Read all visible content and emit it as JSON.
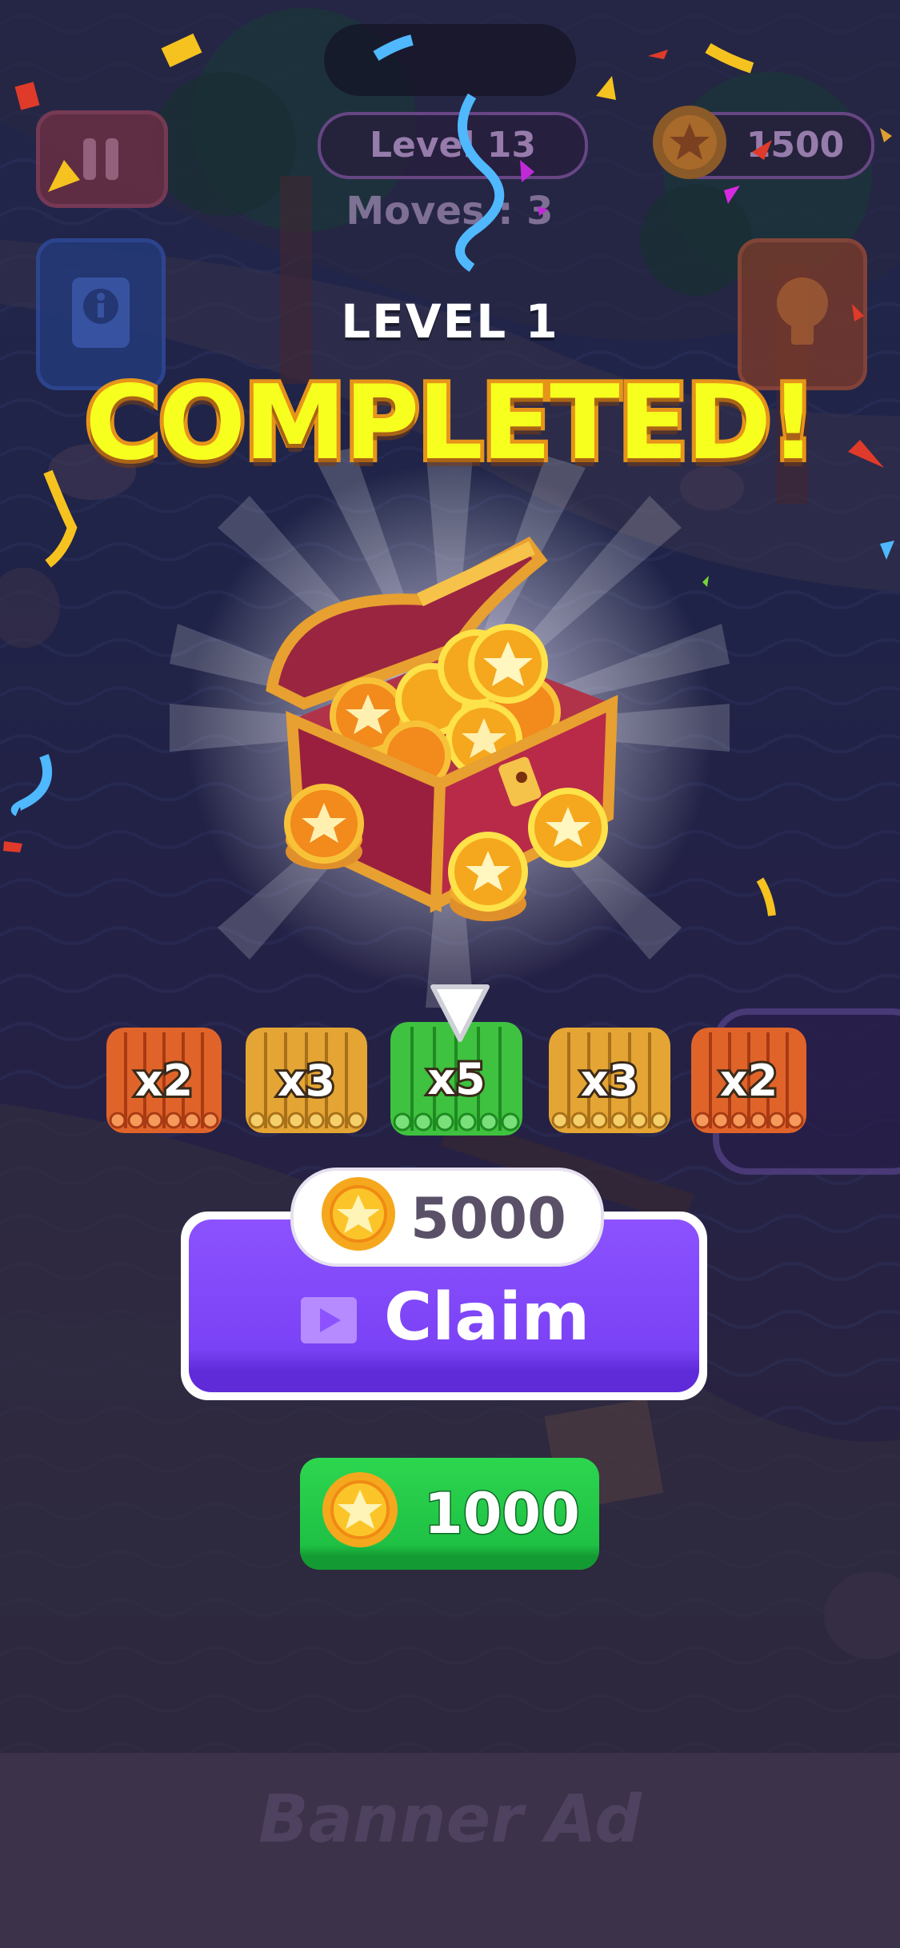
{
  "hud": {
    "level_label": "Level 13",
    "moves_label": "Moves : 3",
    "coins": "1500",
    "pause_icon": "pause-icon",
    "info_icon": "info-book-icon",
    "hint_icon": "lightbulb-icon"
  },
  "result": {
    "level_text": "LEVEL 1",
    "completed_text": "COMPLETED!"
  },
  "multipliers": [
    {
      "label": "x2",
      "color": "#e0642a"
    },
    {
      "label": "x3",
      "color": "#e4a534"
    },
    {
      "label": "x5",
      "color": "#3fc23f"
    },
    {
      "label": "x3",
      "color": "#e4a534"
    },
    {
      "label": "x2",
      "color": "#e0642a"
    }
  ],
  "selected_multiplier": "x5",
  "claim": {
    "reward_amount": "5000",
    "label": "Claim",
    "icon": "video-play-icon"
  },
  "skip": {
    "amount": "1000",
    "icon": "coin-icon"
  },
  "banner": {
    "text": "Banner Ad"
  },
  "colors": {
    "title_fill": "#f7ff1f",
    "title_stroke": "#e7941a",
    "claim_purple": "#8c52ff",
    "skip_green": "#1fc144"
  }
}
